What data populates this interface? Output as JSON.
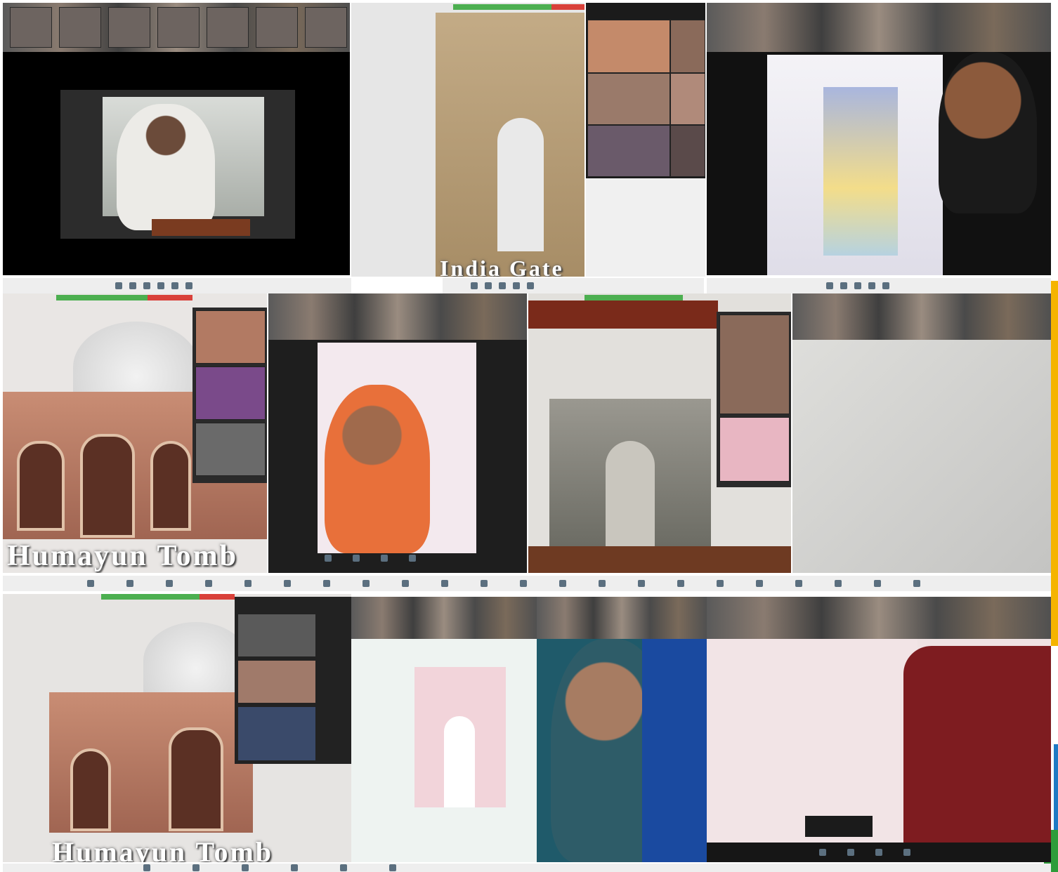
{
  "collage": {
    "captions": {
      "india_gate": "India Gate",
      "humayun_tomb_1": "Humayun Tomb",
      "humayun_tomb_2": "Humayun Tomb"
    },
    "tiles": [
      {
        "id": "speaker-presentation"
      },
      {
        "id": "india-gate-share"
      },
      {
        "id": "participant-gallery-top"
      },
      {
        "id": "student-holding-worksheet"
      },
      {
        "id": "humayun-tomb-share"
      },
      {
        "id": "student-video-call"
      },
      {
        "id": "gateway-of-india-share"
      },
      {
        "id": "worksheet-closeup"
      },
      {
        "id": "humayun-tomb-share-2"
      },
      {
        "id": "india-gate-drawing"
      },
      {
        "id": "student-portrait"
      },
      {
        "id": "worksheet-with-hand"
      }
    ]
  },
  "colors": {
    "toolbar_bg": "#eeeeee",
    "progress_green": "#4caf50",
    "progress_red": "#d9413a",
    "edge_yellow": "#f5b400",
    "edge_blue": "#1f7ac4"
  }
}
